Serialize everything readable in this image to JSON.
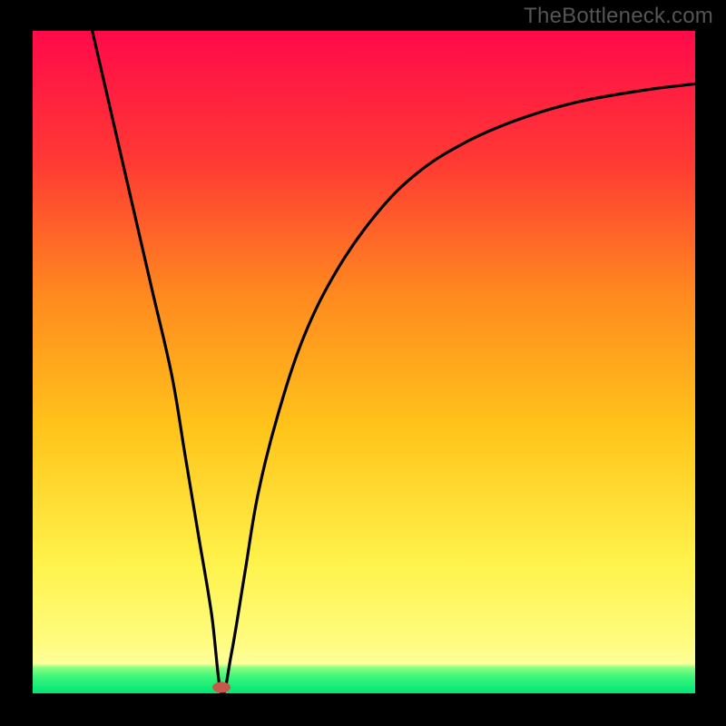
{
  "watermark": "TheBottleneck.com",
  "chart_data": {
    "type": "line",
    "title": "",
    "xlabel": "",
    "ylabel": "",
    "xlim": [
      0,
      100
    ],
    "ylim": [
      0,
      100
    ],
    "series": [
      {
        "name": "curve",
        "x": [
          9,
          12,
          15,
          18,
          21,
          23,
          25,
          27,
          28.5,
          30,
          32,
          34,
          37,
          41,
          46,
          52,
          58,
          65,
          73,
          82,
          92,
          100
        ],
        "y": [
          100,
          87,
          74,
          61,
          48,
          36,
          24,
          12,
          0,
          6,
          18,
          30,
          42,
          54,
          64,
          72.5,
          78.5,
          83,
          86.5,
          89.2,
          91,
          92
        ]
      }
    ],
    "marker": {
      "x": 28.5,
      "y": 0.9,
      "color": "#c55a4a"
    },
    "gradient_stops": [
      {
        "pos": 0.0,
        "color": "#ff0a4a"
      },
      {
        "pos": 0.2,
        "color": "#ff3a33"
      },
      {
        "pos": 0.4,
        "color": "#ff8a1f"
      },
      {
        "pos": 0.6,
        "color": "#ffc41a"
      },
      {
        "pos": 0.8,
        "color": "#fff24a"
      },
      {
        "pos": 0.92,
        "color": "#fffc7e"
      },
      {
        "pos": 0.955,
        "color": "#ffff9a"
      },
      {
        "pos": 0.961,
        "color": "#8bff82"
      },
      {
        "pos": 0.975,
        "color": "#3df57a"
      },
      {
        "pos": 1.0,
        "color": "#00e676"
      }
    ]
  }
}
